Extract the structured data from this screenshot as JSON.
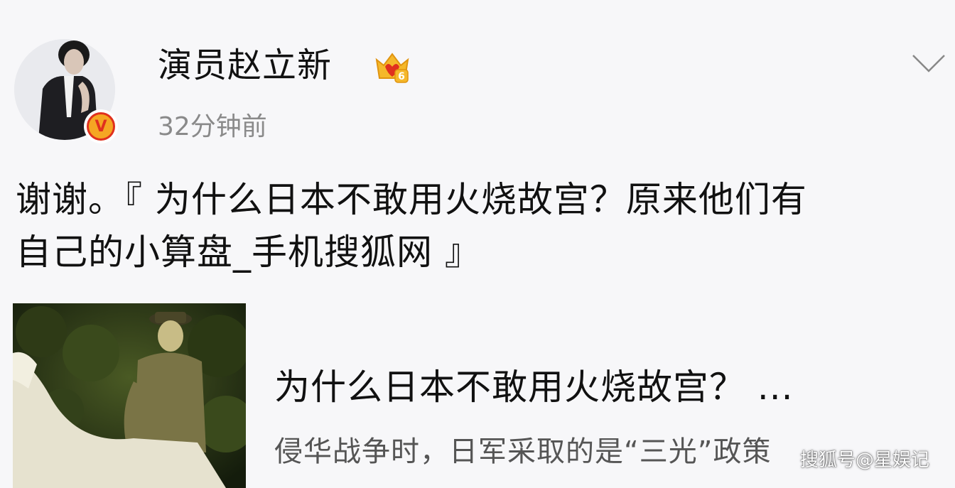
{
  "post": {
    "author": {
      "name": "演员赵立新",
      "avatar_icon": "avatar-photo",
      "verified_icon": "verified-v-badge",
      "verified_symbol": "V",
      "vip_icon": "vip-level-crown",
      "vip_level": "6"
    },
    "time": "32分钟前",
    "more_icon": "chevron-down-icon",
    "text_line1": "谢谢。『 为什么日本不敢用火烧故宫？原来他们有",
    "text_line2": "自己的小算盘_手机搜狐网 』",
    "link_card": {
      "image_icon": "rider-on-white-horse-photo",
      "title": "为什么日本不敢用火烧故宫？ ...",
      "description": "侵华战争时，日军采取的是“三光”政策"
    }
  },
  "watermark": "搜狐号@星娱记",
  "colors": {
    "background": "#f7f7f9",
    "text_primary": "#111111",
    "text_secondary": "#8a8a8a",
    "badge_orange": "#f5a623",
    "badge_red": "#e0301e"
  }
}
